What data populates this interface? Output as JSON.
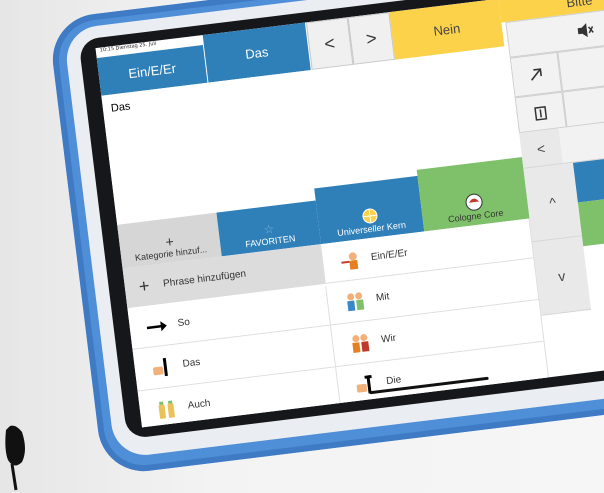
{
  "status_bar": {
    "time_date": "10:15  Dienstag 25. Juli"
  },
  "top_bar": {
    "tab_1": "Ein/E/Er",
    "tab_2": "Das",
    "back": "<",
    "forward": ">",
    "nein": "Nein",
    "bitte": "Bitte"
  },
  "message": {
    "text": "Das"
  },
  "categories": {
    "add": "Kategorie hinzuf...",
    "favorites": "FAVORITEN",
    "universal": "Universeller Kern",
    "cologne": "Cologne Core"
  },
  "phrases": {
    "add_phrase": "Phrase hinzufügen"
  },
  "left_column": [
    {
      "label": "So",
      "icon": "arrow-right-icon"
    },
    {
      "label": "Das",
      "icon": "pointing-hand-icon"
    },
    {
      "label": "Auch",
      "icon": "two-bottles-icon"
    }
  ],
  "right_column": [
    {
      "label": "Ein/E/Er",
      "icon": "person-pointing-icon"
    },
    {
      "label": "Mit",
      "icon": "two-people-icon"
    },
    {
      "label": "Wir",
      "icon": "group-icon"
    },
    {
      "label": "Die",
      "icon": "pointing-hand-icon"
    }
  ],
  "side_panel": {
    "speaker": "speaker-icon",
    "expand": "expand-arrow-icon",
    "settings": "gear-icon",
    "delete_left": "delete-word-icon",
    "delete_right": "delete-char-icon",
    "back_arrow": "<",
    "up": "^",
    "down": "v"
  },
  "colors": {
    "blue": "#2f7fb8",
    "yellow": "#fbd24a",
    "green": "#7fc16a",
    "case": "#4f8fd8"
  }
}
